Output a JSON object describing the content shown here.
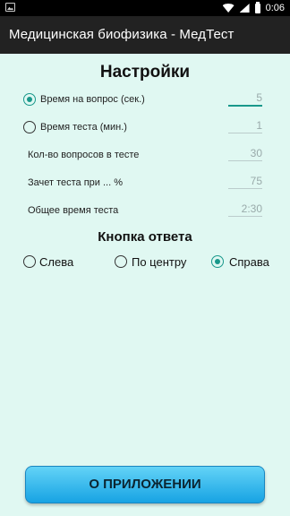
{
  "status_bar": {
    "time": "0:06"
  },
  "app_bar": {
    "title": "Медицинская биофизика - МедТест"
  },
  "settings": {
    "title": "Настройки",
    "rows": [
      {
        "label": "Время на вопрос (сек.)",
        "value": "5",
        "radio_checked": true
      },
      {
        "label": "Время теста (мин.)",
        "value": "1",
        "radio_checked": false
      },
      {
        "label": "Кол-во вопросов в тесте",
        "value": "30"
      },
      {
        "label": "Зачет теста при ... %",
        "value": "75"
      },
      {
        "label": "Общее время теста",
        "value": "2:30"
      }
    ]
  },
  "answer_button": {
    "title": "Кнопка ответа",
    "options": [
      {
        "label": "Слева",
        "checked": false
      },
      {
        "label": "По центру",
        "checked": false
      },
      {
        "label": "Справа",
        "checked": true
      }
    ]
  },
  "about_button": {
    "label": "О ПРИЛОЖЕНИИ"
  },
  "colors": {
    "accent": "#19988b",
    "background": "#e0f8f2",
    "app_bar": "#222222",
    "button": "#17a3e3"
  }
}
